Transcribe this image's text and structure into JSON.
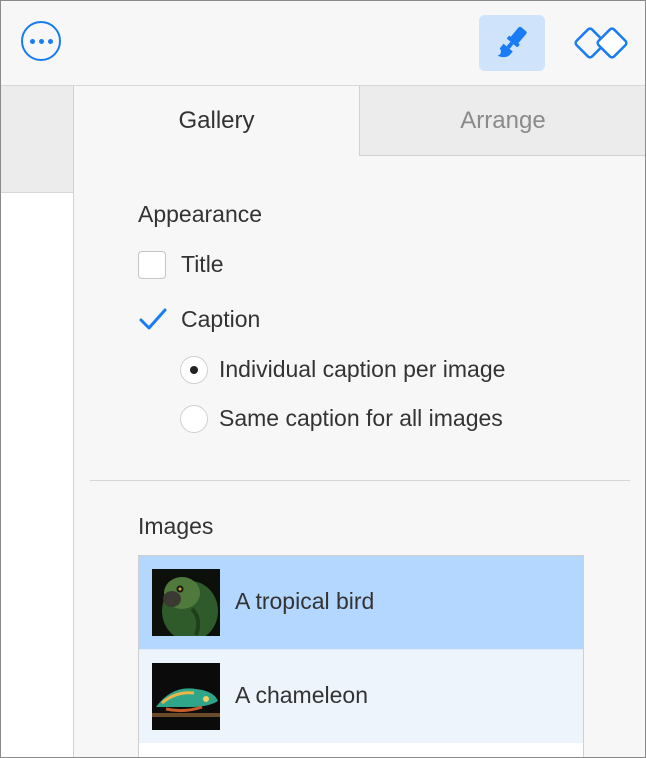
{
  "toolbar": {
    "more_icon": "ellipsis-circle-icon",
    "format_icon": "paintbrush-icon",
    "arrange_icon": "arrange-diamond-icon",
    "accent_color": "#1a7cf5"
  },
  "tabs": [
    {
      "label": "Gallery",
      "selected": true
    },
    {
      "label": "Arrange",
      "selected": false
    }
  ],
  "appearance": {
    "heading": "Appearance",
    "title_option": {
      "label": "Title",
      "checked": false
    },
    "caption_option": {
      "label": "Caption",
      "checked": true
    },
    "caption_modes": [
      {
        "label": "Individual caption per image",
        "selected": true
      },
      {
        "label": "Same caption for all images",
        "selected": false
      }
    ]
  },
  "images": {
    "heading": "Images",
    "items": [
      {
        "label": "A tropical bird",
        "selected": true
      },
      {
        "label": "A chameleon",
        "selected": false
      }
    ]
  }
}
